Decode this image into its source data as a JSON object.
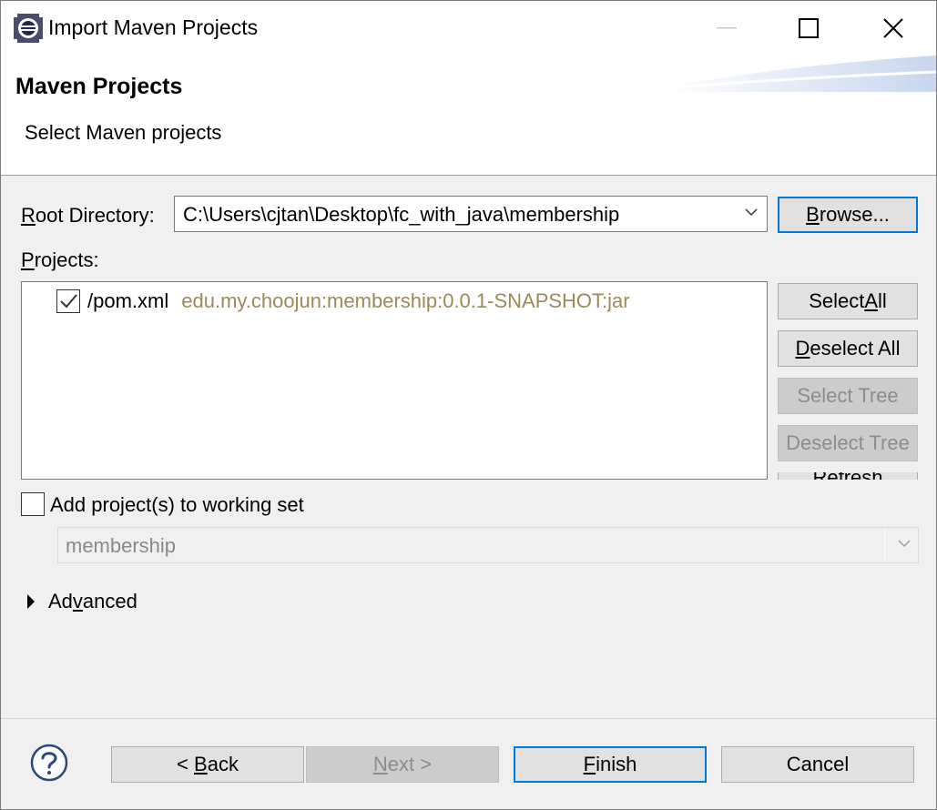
{
  "window": {
    "title": "Import Maven Projects"
  },
  "header": {
    "title": "Maven Projects",
    "description": "Select Maven projects"
  },
  "root_directory": {
    "label_pre": "",
    "label_mnemonic": "R",
    "label_post": "oot Directory:",
    "value": "C:\\Users\\cjtan\\Desktop\\fc_with_java\\membership",
    "browse_mnemonic": "B",
    "browse_post": "rowse..."
  },
  "projects": {
    "label_mnemonic": "P",
    "label_post": "rojects:",
    "items": [
      {
        "checked": true,
        "path": "/pom.xml",
        "gav": "edu.my.choojun:membership:0.0.1-SNAPSHOT:jar"
      }
    ]
  },
  "side_buttons": {
    "select_all_pre": "Select ",
    "select_all_mnemonic": "A",
    "select_all_post": "ll",
    "deselect_all_mnemonic": "D",
    "deselect_all_post": "eselect All",
    "select_tree": "Select Tree",
    "deselect_tree": "Deselect Tree",
    "refresh": "Refresh"
  },
  "working_set": {
    "checked": false,
    "label": "Add project(s) to working set",
    "value": "membership"
  },
  "advanced": {
    "pre": "Ad",
    "mnemonic": "v",
    "post": "anced"
  },
  "footer": {
    "back_pre": "< ",
    "back_mnemonic": "B",
    "back_post": "ack",
    "next_mnemonic": "N",
    "next_post": "ext >",
    "finish_mnemonic": "F",
    "finish_post": "inish",
    "cancel": "Cancel"
  },
  "colors": {
    "focus_border": "#0078d7",
    "gav_text": "#9c8a55",
    "disabled_text": "#8d8d8d"
  }
}
